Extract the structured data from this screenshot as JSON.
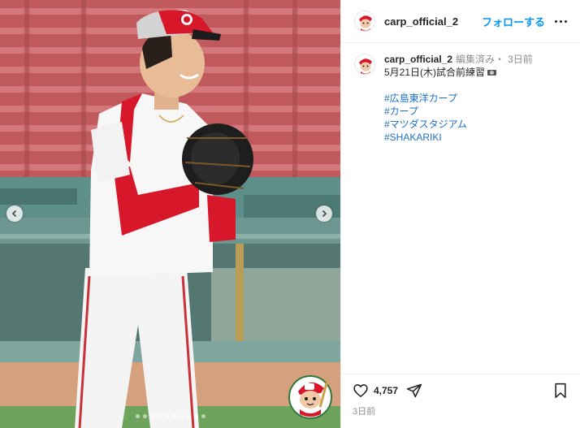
{
  "post": {
    "username": "carp_official_2",
    "follow_label": "フォローする",
    "caption": {
      "username": "carp_official_2",
      "edited": "編集済み・",
      "time_ago": "3日前",
      "text": "5月21日(木)試合前練習",
      "hashtags": [
        "#広島東洋カープ",
        "#カープ",
        "#マツダスタジアム",
        "#SHAKARIKI"
      ]
    },
    "likes": "4,757",
    "posted_ago": "3日前"
  },
  "carousel": {
    "slide_count": 10,
    "active_index": 8
  },
  "colors": {
    "accent": "#0095f6",
    "hashtag": "#1d6fbf",
    "carp_red": "#d7182a"
  },
  "icons": [
    "heart-icon",
    "share-icon",
    "bookmark-icon",
    "more-icon",
    "chevron-left-icon",
    "chevron-right-icon"
  ]
}
